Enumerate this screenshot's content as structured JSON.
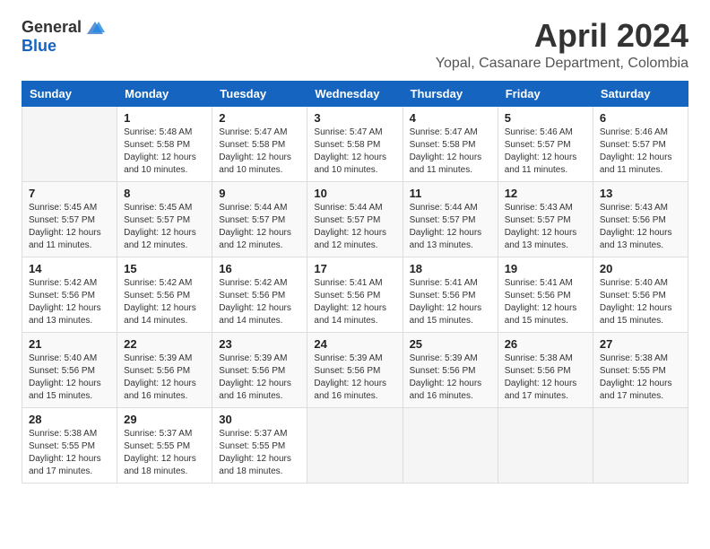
{
  "header": {
    "logo_general": "General",
    "logo_blue": "Blue",
    "month_title": "April 2024",
    "location": "Yopal, Casanare Department, Colombia"
  },
  "weekdays": [
    "Sunday",
    "Monday",
    "Tuesday",
    "Wednesday",
    "Thursday",
    "Friday",
    "Saturday"
  ],
  "weeks": [
    [
      {
        "day": "",
        "sunrise": "",
        "sunset": "",
        "daylight": ""
      },
      {
        "day": "1",
        "sunrise": "Sunrise: 5:48 AM",
        "sunset": "Sunset: 5:58 PM",
        "daylight": "Daylight: 12 hours and 10 minutes."
      },
      {
        "day": "2",
        "sunrise": "Sunrise: 5:47 AM",
        "sunset": "Sunset: 5:58 PM",
        "daylight": "Daylight: 12 hours and 10 minutes."
      },
      {
        "day": "3",
        "sunrise": "Sunrise: 5:47 AM",
        "sunset": "Sunset: 5:58 PM",
        "daylight": "Daylight: 12 hours and 10 minutes."
      },
      {
        "day": "4",
        "sunrise": "Sunrise: 5:47 AM",
        "sunset": "Sunset: 5:58 PM",
        "daylight": "Daylight: 12 hours and 11 minutes."
      },
      {
        "day": "5",
        "sunrise": "Sunrise: 5:46 AM",
        "sunset": "Sunset: 5:57 PM",
        "daylight": "Daylight: 12 hours and 11 minutes."
      },
      {
        "day": "6",
        "sunrise": "Sunrise: 5:46 AM",
        "sunset": "Sunset: 5:57 PM",
        "daylight": "Daylight: 12 hours and 11 minutes."
      }
    ],
    [
      {
        "day": "7",
        "sunrise": "Sunrise: 5:45 AM",
        "sunset": "Sunset: 5:57 PM",
        "daylight": "Daylight: 12 hours and 11 minutes."
      },
      {
        "day": "8",
        "sunrise": "Sunrise: 5:45 AM",
        "sunset": "Sunset: 5:57 PM",
        "daylight": "Daylight: 12 hours and 12 minutes."
      },
      {
        "day": "9",
        "sunrise": "Sunrise: 5:44 AM",
        "sunset": "Sunset: 5:57 PM",
        "daylight": "Daylight: 12 hours and 12 minutes."
      },
      {
        "day": "10",
        "sunrise": "Sunrise: 5:44 AM",
        "sunset": "Sunset: 5:57 PM",
        "daylight": "Daylight: 12 hours and 12 minutes."
      },
      {
        "day": "11",
        "sunrise": "Sunrise: 5:44 AM",
        "sunset": "Sunset: 5:57 PM",
        "daylight": "Daylight: 12 hours and 13 minutes."
      },
      {
        "day": "12",
        "sunrise": "Sunrise: 5:43 AM",
        "sunset": "Sunset: 5:57 PM",
        "daylight": "Daylight: 12 hours and 13 minutes."
      },
      {
        "day": "13",
        "sunrise": "Sunrise: 5:43 AM",
        "sunset": "Sunset: 5:56 PM",
        "daylight": "Daylight: 12 hours and 13 minutes."
      }
    ],
    [
      {
        "day": "14",
        "sunrise": "Sunrise: 5:42 AM",
        "sunset": "Sunset: 5:56 PM",
        "daylight": "Daylight: 12 hours and 13 minutes."
      },
      {
        "day": "15",
        "sunrise": "Sunrise: 5:42 AM",
        "sunset": "Sunset: 5:56 PM",
        "daylight": "Daylight: 12 hours and 14 minutes."
      },
      {
        "day": "16",
        "sunrise": "Sunrise: 5:42 AM",
        "sunset": "Sunset: 5:56 PM",
        "daylight": "Daylight: 12 hours and 14 minutes."
      },
      {
        "day": "17",
        "sunrise": "Sunrise: 5:41 AM",
        "sunset": "Sunset: 5:56 PM",
        "daylight": "Daylight: 12 hours and 14 minutes."
      },
      {
        "day": "18",
        "sunrise": "Sunrise: 5:41 AM",
        "sunset": "Sunset: 5:56 PM",
        "daylight": "Daylight: 12 hours and 15 minutes."
      },
      {
        "day": "19",
        "sunrise": "Sunrise: 5:41 AM",
        "sunset": "Sunset: 5:56 PM",
        "daylight": "Daylight: 12 hours and 15 minutes."
      },
      {
        "day": "20",
        "sunrise": "Sunrise: 5:40 AM",
        "sunset": "Sunset: 5:56 PM",
        "daylight": "Daylight: 12 hours and 15 minutes."
      }
    ],
    [
      {
        "day": "21",
        "sunrise": "Sunrise: 5:40 AM",
        "sunset": "Sunset: 5:56 PM",
        "daylight": "Daylight: 12 hours and 15 minutes."
      },
      {
        "day": "22",
        "sunrise": "Sunrise: 5:39 AM",
        "sunset": "Sunset: 5:56 PM",
        "daylight": "Daylight: 12 hours and 16 minutes."
      },
      {
        "day": "23",
        "sunrise": "Sunrise: 5:39 AM",
        "sunset": "Sunset: 5:56 PM",
        "daylight": "Daylight: 12 hours and 16 minutes."
      },
      {
        "day": "24",
        "sunrise": "Sunrise: 5:39 AM",
        "sunset": "Sunset: 5:56 PM",
        "daylight": "Daylight: 12 hours and 16 minutes."
      },
      {
        "day": "25",
        "sunrise": "Sunrise: 5:39 AM",
        "sunset": "Sunset: 5:56 PM",
        "daylight": "Daylight: 12 hours and 16 minutes."
      },
      {
        "day": "26",
        "sunrise": "Sunrise: 5:38 AM",
        "sunset": "Sunset: 5:56 PM",
        "daylight": "Daylight: 12 hours and 17 minutes."
      },
      {
        "day": "27",
        "sunrise": "Sunrise: 5:38 AM",
        "sunset": "Sunset: 5:55 PM",
        "daylight": "Daylight: 12 hours and 17 minutes."
      }
    ],
    [
      {
        "day": "28",
        "sunrise": "Sunrise: 5:38 AM",
        "sunset": "Sunset: 5:55 PM",
        "daylight": "Daylight: 12 hours and 17 minutes."
      },
      {
        "day": "29",
        "sunrise": "Sunrise: 5:37 AM",
        "sunset": "Sunset: 5:55 PM",
        "daylight": "Daylight: 12 hours and 18 minutes."
      },
      {
        "day": "30",
        "sunrise": "Sunrise: 5:37 AM",
        "sunset": "Sunset: 5:55 PM",
        "daylight": "Daylight: 12 hours and 18 minutes."
      },
      {
        "day": "",
        "sunrise": "",
        "sunset": "",
        "daylight": ""
      },
      {
        "day": "",
        "sunrise": "",
        "sunset": "",
        "daylight": ""
      },
      {
        "day": "",
        "sunrise": "",
        "sunset": "",
        "daylight": ""
      },
      {
        "day": "",
        "sunrise": "",
        "sunset": "",
        "daylight": ""
      }
    ]
  ]
}
